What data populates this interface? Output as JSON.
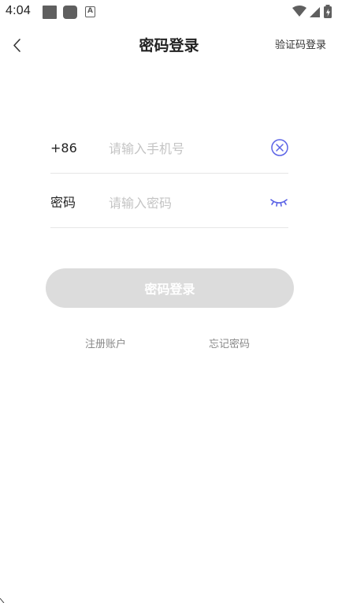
{
  "status_bar": {
    "time": "4:04",
    "notification_a": "A",
    "icons": [
      "square-notification-icon",
      "rounded-notification-icon",
      "a-notification-icon",
      "wifi-icon",
      "signal-icon",
      "battery-icon"
    ]
  },
  "header": {
    "title": "密码登录",
    "sms_login_label": "验证码登录",
    "back_icon": "chevron-left-icon"
  },
  "form": {
    "phone_label": "+86",
    "phone_placeholder": "请输入手机号",
    "phone_value": "",
    "password_label": "密码",
    "password_placeholder": "请输入密码",
    "password_value": "",
    "clear_icon": "clear-circle-icon",
    "eye_icon": "eye-closed-icon"
  },
  "actions": {
    "login_label": "密码登录",
    "register_label": "注册账户",
    "forgot_label": "忘记密码"
  },
  "colors": {
    "accent": "#5b63e6",
    "button_disabled": "#dcdcdc",
    "placeholder": "#c4c4c4",
    "divider": "#e6e6e6"
  }
}
